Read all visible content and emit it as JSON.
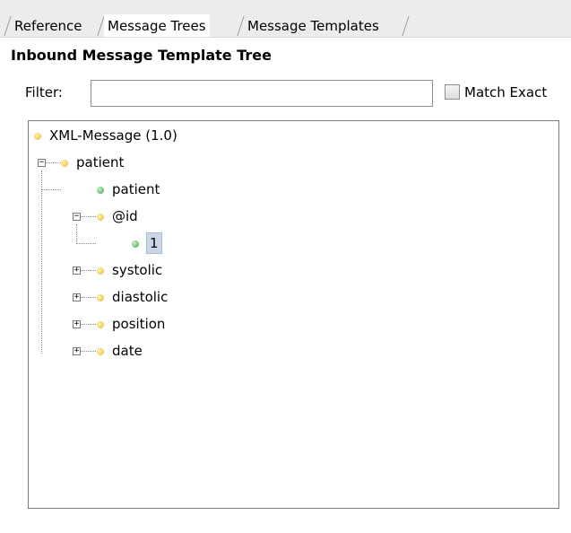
{
  "tabs": [
    {
      "label": "Reference",
      "active": false
    },
    {
      "label": "Message Trees",
      "active": true
    },
    {
      "label": "Message Templates",
      "active": false
    }
  ],
  "heading": "Inbound Message Template Tree",
  "filter": {
    "label": "Filter:",
    "value": ""
  },
  "match_exact": {
    "label": "Match Exact",
    "checked": false
  },
  "tree": {
    "root": "XML-Message (1.0)",
    "patient": "patient",
    "patient_child": "patient",
    "id": "@id",
    "id_value": "1",
    "systolic": "systolic",
    "diastolic": "diastolic",
    "position": "position",
    "date": "date"
  },
  "colors": {
    "element_dot": "#e8b830",
    "value_dot": "#3fa54a",
    "selection": "#c8d6e6"
  }
}
